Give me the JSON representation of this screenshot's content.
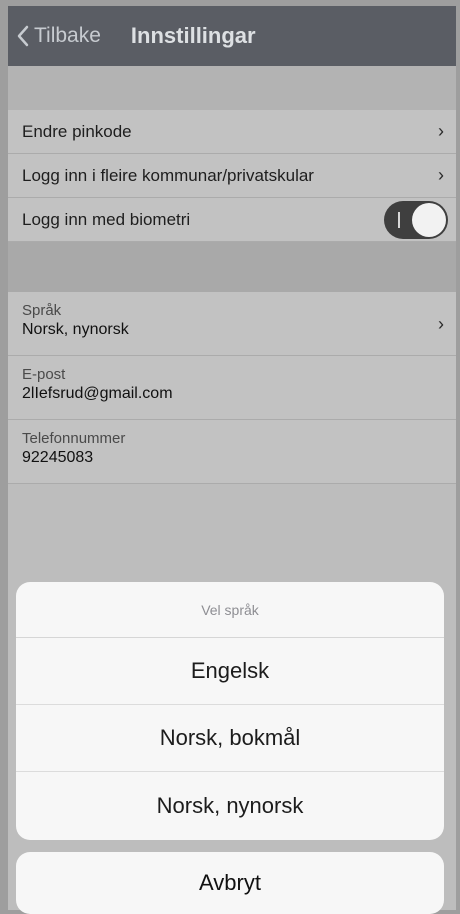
{
  "navbar": {
    "back_label": "Tilbake",
    "title": "Innstillingar"
  },
  "settings": {
    "rows": [
      {
        "label": "Endre pinkode",
        "type": "link"
      },
      {
        "label": "Logg inn i fleire kommunar/privatskular",
        "type": "link"
      },
      {
        "label": "Logg inn med biometri",
        "type": "toggle",
        "toggle_on": true
      }
    ],
    "language": {
      "label": "Språk",
      "value": "Norsk, nynorsk"
    },
    "email": {
      "label": "E-post",
      "value": "2lIefsrud@gmail.com"
    },
    "phone": {
      "label": "Telefonnummer",
      "value": "92245083"
    }
  },
  "action_sheet": {
    "title": "Vel språk",
    "options": [
      "Engelsk",
      "Norsk, bokmål",
      "Norsk, nynorsk"
    ],
    "cancel_label": "Avbryt"
  },
  "icons": {
    "back": "chevron-left-icon",
    "row_chevron": "chevron-right-icon"
  }
}
